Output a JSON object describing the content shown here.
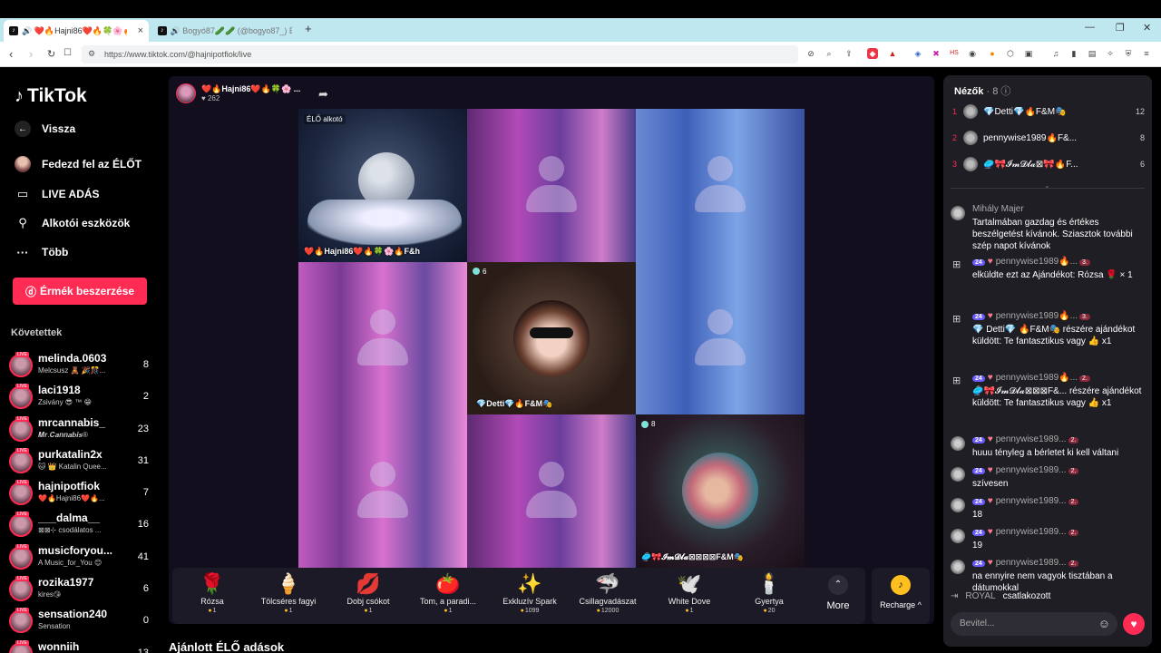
{
  "browser": {
    "tabs": [
      {
        "title": "🔊 ❤️🔥Hajni86❤️🔥🍀🌸🔥 ..."
      },
      {
        "title": "🔊 Bogyó87🥒🥒 (@bogyo87_) ÉL..."
      }
    ],
    "url": "https://www.tiktok.com/@hajnipotfiok/live"
  },
  "sidebar": {
    "logo": "TikTok",
    "nav": [
      {
        "label": "Vissza",
        "icon": "back-arrow-icon"
      },
      {
        "label": "Fedezd fel az ÉLŐT",
        "icon": "avatar"
      },
      {
        "label": "LIVE ADÁS",
        "icon": "camera-icon"
      },
      {
        "label": "Alkotói eszközök",
        "icon": "lightbulb-icon"
      },
      {
        "label": "Több",
        "icon": "more-icon"
      }
    ],
    "coins_button": "Érmék beszerzése",
    "following_header": "Követettek",
    "following": [
      {
        "name": "melinda.0603",
        "sub": "Melcsusz 🧸 🎉🎊...",
        "count": "8"
      },
      {
        "name": "laci1918",
        "sub": "Zsivány 😎 ™ 😁",
        "count": "2"
      },
      {
        "name": "mrcannabis_",
        "sub": "𝑴𝒓.𝑪𝒂𝒏𝒏𝒂𝒃𝒊𝒔®",
        "count": "23"
      },
      {
        "name": "purkatalin2x",
        "sub": "🐱 👑 Katalin Quee...",
        "count": "31"
      },
      {
        "name": "hajnipotfiok",
        "sub": "❤️🔥Hajni86❤️🔥...",
        "count": "7"
      },
      {
        "name": "___dalma__",
        "sub": "⊠⊠⊹ csodálatos ...",
        "count": "16"
      },
      {
        "name": "musicforyou...",
        "sub": "A Music_for_You 😊",
        "count": "41"
      },
      {
        "name": "rozika1977",
        "sub": "kires😘",
        "count": "6"
      },
      {
        "name": "sensation240",
        "sub": "Sensation",
        "count": "0"
      },
      {
        "name": "wonniih",
        "sub": "",
        "count": "13"
      }
    ]
  },
  "stream": {
    "host_name": "❤️🔥Hajni86❤️🔥🍀🌸 ...",
    "host_likes": "♥ 262",
    "elo_tag": "ÉLŐ alkotó",
    "cell1_label": "❤️🔥Hajni86❤️🔥🍀🌸🔥F&h",
    "cell5_viewers": "6",
    "cell5_label": "💎Detti💎🔥F&M🎭",
    "cell9_viewers": "8",
    "cell9_label": "🥏🎀𝓘𝓶𝓓𝓵𝓪⊠⊠⊠⊠F&M🎭"
  },
  "gifts": [
    {
      "name": "Rózsa",
      "price": "1",
      "icon": "🌹"
    },
    {
      "name": "Tölcséres fagyi",
      "price": "1",
      "icon": "🍦"
    },
    {
      "name": "Dobj csókot",
      "price": "1",
      "icon": "💋"
    },
    {
      "name": "Tom, a paradi...",
      "price": "1",
      "icon": "🍅"
    },
    {
      "name": "Exkluzív Spark",
      "price": "1099",
      "icon": "✨"
    },
    {
      "name": "Csillagvadászat",
      "price": "12000",
      "icon": "🦈"
    },
    {
      "name": "White Dove",
      "price": "1",
      "icon": "🕊️"
    },
    {
      "name": "Gyertya",
      "price": "20",
      "icon": "🕯️"
    }
  ],
  "gift_more": "More",
  "recharge": "Recharge ^",
  "recommended": "Ajánlott ÉLŐ adások",
  "chat": {
    "viewers_title": "Nézők",
    "viewers_count": "· 8",
    "top_viewers": [
      {
        "rank": "1",
        "name": "💎Detti💎🔥F&M🎭",
        "score": "12"
      },
      {
        "rank": "2",
        "name": "pennywise1989🔥F&...",
        "score": "8"
      },
      {
        "rank": "3",
        "name": "🥏🎀𝓘𝓶𝓓𝓵𝓪⊠🎀🔥F...",
        "score": "6"
      }
    ],
    "messages": [
      {
        "user": "Mihály Majer",
        "text": "Tartalmában gazdag és értékes beszélgetést kívánok. Sziasztok további szép napot kívánok"
      },
      {
        "user": "pennywise1989🔥...",
        "lvl": "24",
        "badge": "3.",
        "text": "elküldte ezt az Ajándékot: Rózsa 🌹 × 1"
      },
      {
        "user": "pennywise1989🔥...",
        "lvl": "24",
        "badge": "3.",
        "text": "💎 Detti💎 🔥F&M🎭 részére ajándékot küldött: Te fantasztikus vagy 👍 x1"
      },
      {
        "user": "pennywise1989🔥...",
        "lvl": "24",
        "badge": "2.",
        "text": "🥏🎀𝓘𝓶𝓓𝓵𝓪⊠⊠⊠F&... részére ajándékot küldött: Te fantasztikus vagy 👍 x1"
      },
      {
        "user": "pennywise1989...",
        "lvl": "24",
        "badge": "2.",
        "text": "huuu tényleg a bérletet ki kell váltani"
      },
      {
        "user": "pennywise1989...",
        "lvl": "24",
        "badge": "2.",
        "text": "szívesen"
      },
      {
        "user": "pennywise1989...",
        "lvl": "24",
        "badge": "2.",
        "text": "18"
      },
      {
        "user": "pennywise1989...",
        "lvl": "24",
        "badge": "2.",
        "text": "19"
      },
      {
        "user": "pennywise1989...",
        "lvl": "24",
        "badge": "2.",
        "text": "na ennyire nem vagyok tisztában a dátumokkal"
      }
    ],
    "joined_user": "ROYAL",
    "joined_text": "csatlakozott",
    "input_placeholder": "Bevitel..."
  }
}
